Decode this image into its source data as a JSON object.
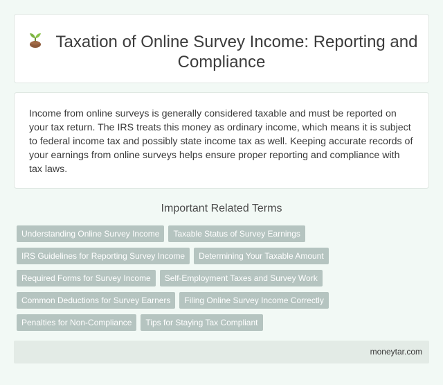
{
  "header": {
    "icon": "seedling-icon",
    "title": "Taxation of Online Survey Income: Reporting and Compliance"
  },
  "description": "Income from online surveys is generally considered taxable and must be reported on your tax return. The IRS treats this money as ordinary income, which means it is subject to federal income tax and possibly state income tax as well. Keeping accurate records of your earnings from online surveys helps ensure proper reporting and compliance with tax laws.",
  "related_terms": {
    "heading": "Important Related Terms",
    "rows": [
      [
        "Understanding Online Survey Income",
        "Taxable Status of Survey Earnings"
      ],
      [
        "IRS Guidelines for Reporting Survey Income",
        "Determining Your Taxable Amount"
      ],
      [
        "Required Forms for Survey Income",
        "Self-Employment Taxes and Survey Work"
      ],
      [
        "Common Deductions for Survey Earners",
        "Filing Online Survey Income Correctly"
      ],
      [
        "Penalties for Non-Compliance",
        "Tips for Staying Tax Compliant"
      ]
    ]
  },
  "footer": {
    "site": "moneytar.com"
  },
  "colors": {
    "background": "#f2f9f5",
    "tag_bg": "#b5c4c0",
    "footer_bg": "#e3ebe6"
  }
}
